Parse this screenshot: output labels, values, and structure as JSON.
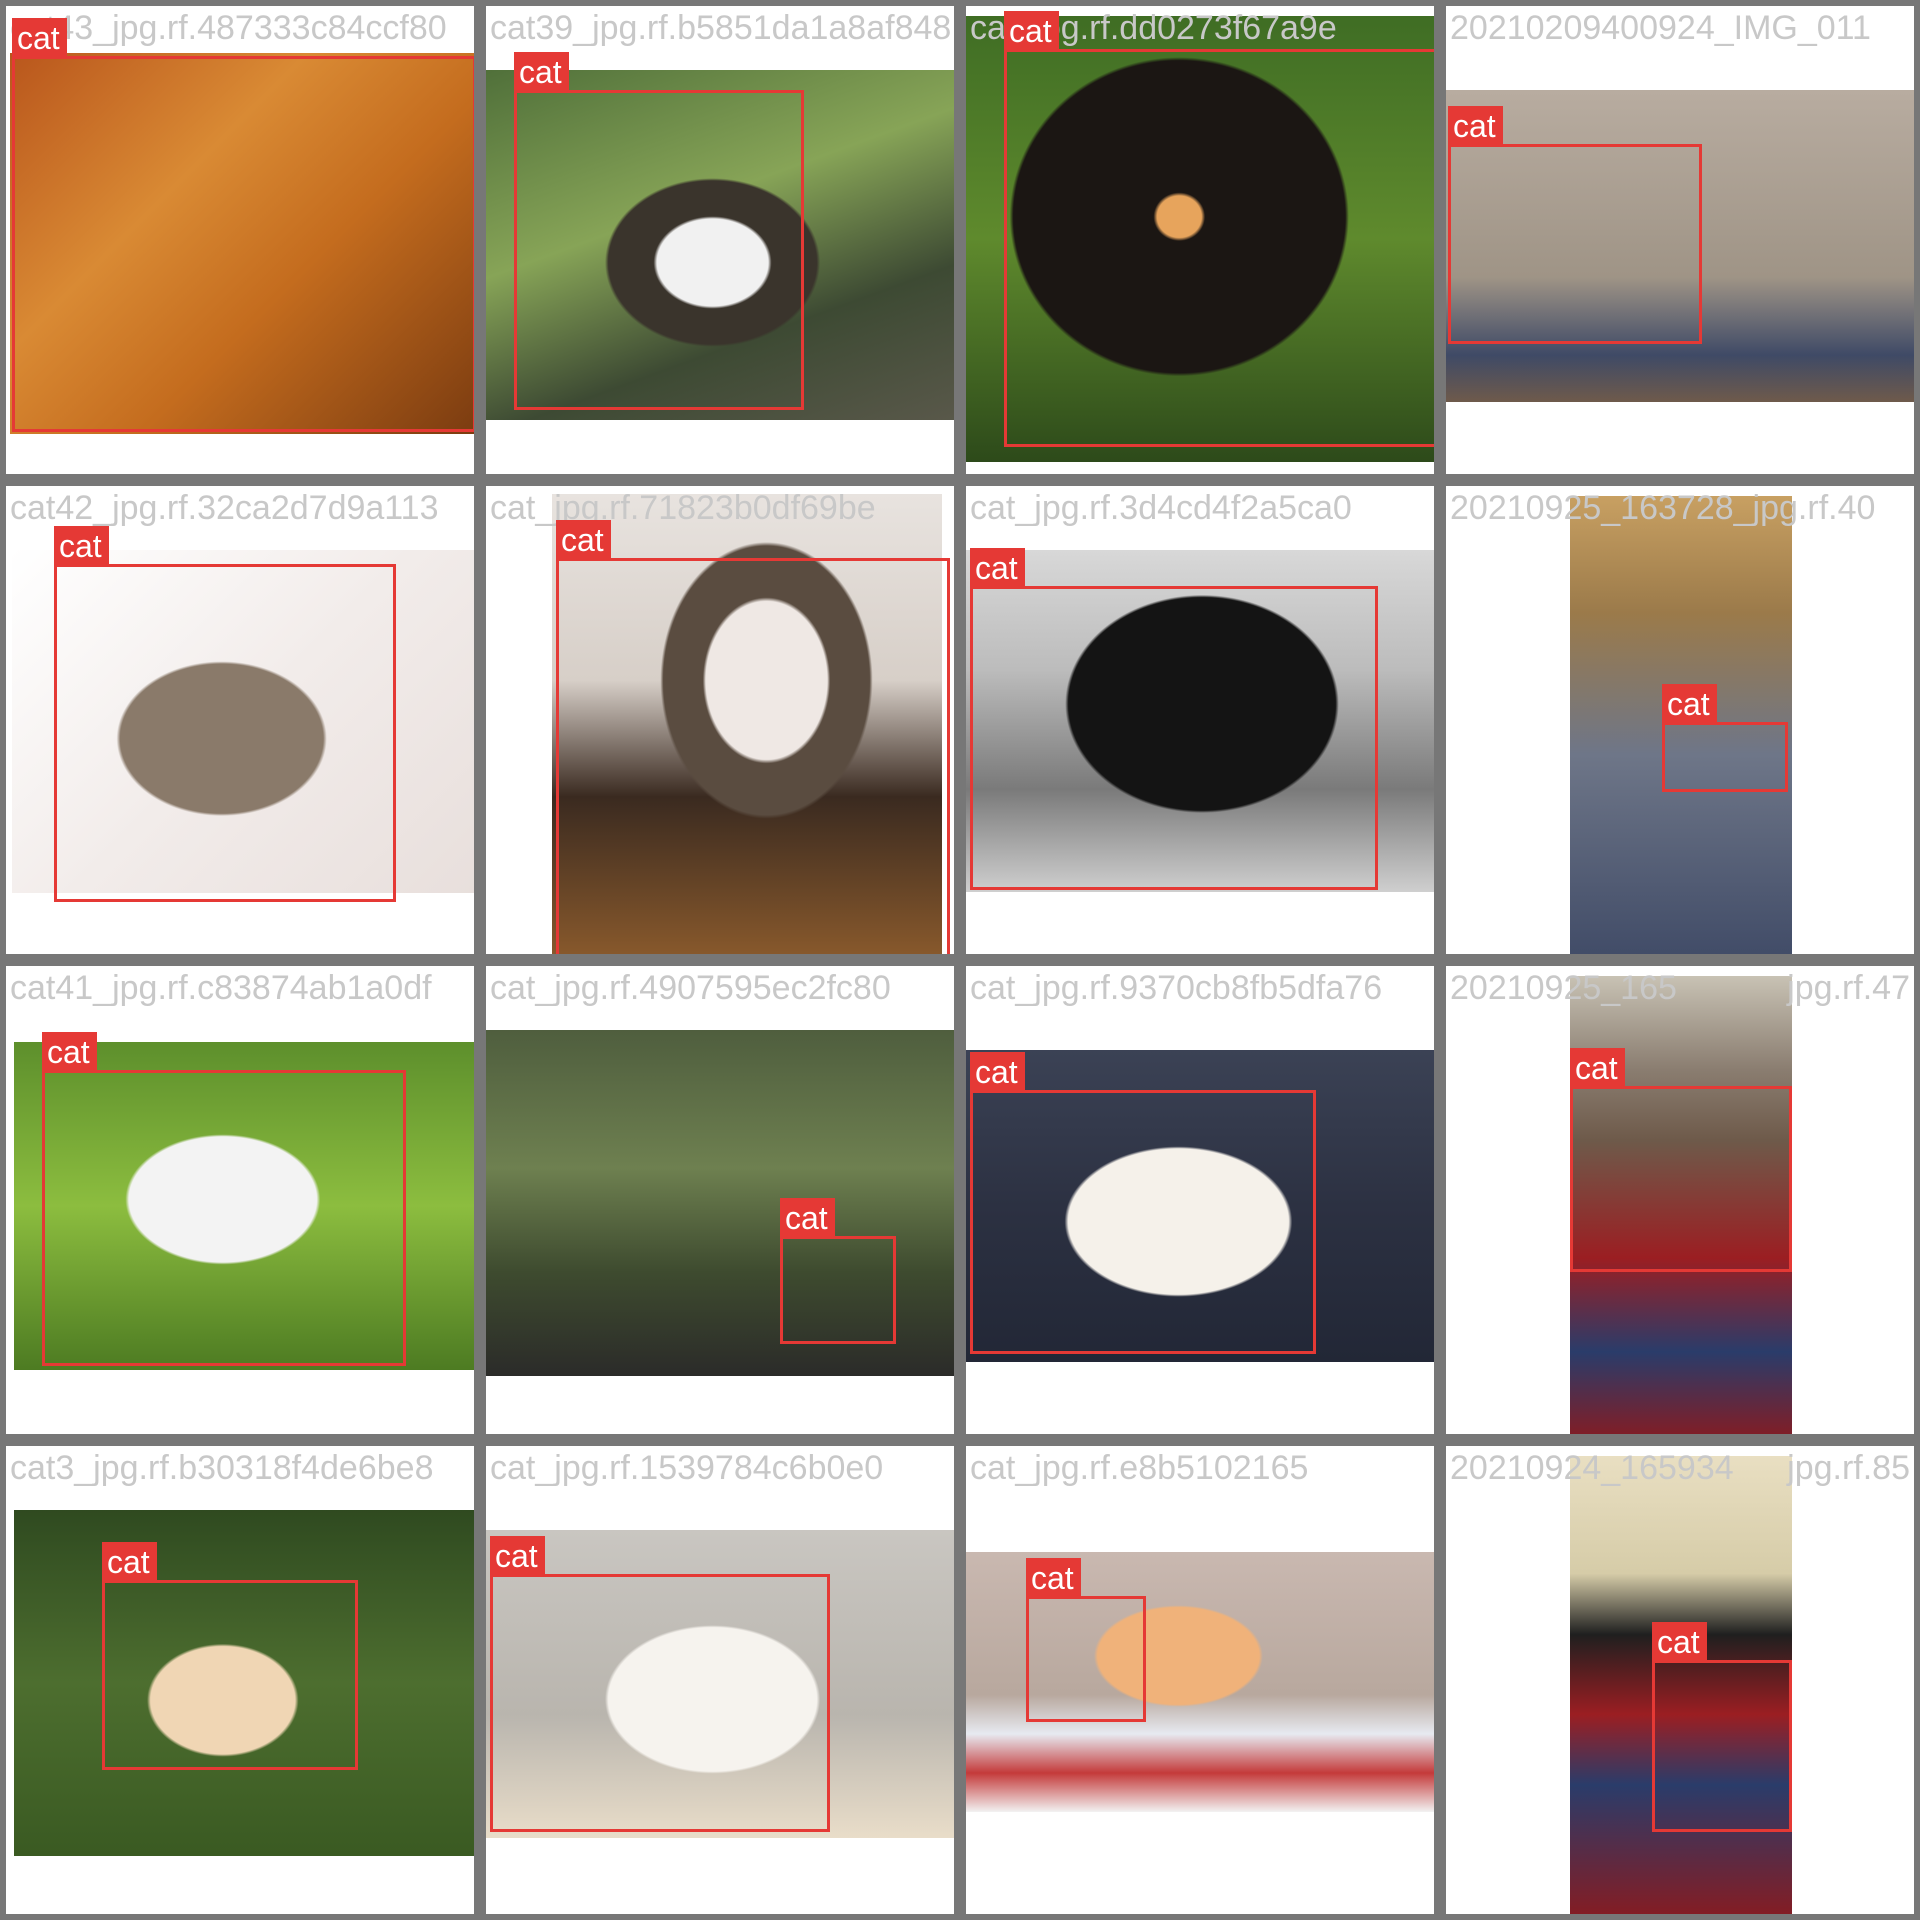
{
  "grid": {
    "rows": 4,
    "cols": 4,
    "border_color": "#777777",
    "box_color": "#e53935",
    "filename_color": "#c8c8c8"
  },
  "tiles": [
    {
      "filename": "cat43_jpg.rf.487333c84ccf80",
      "subject": "orange long-haired cat close-up",
      "boxes": [
        {
          "label": "cat"
        }
      ]
    },
    {
      "filename": "cat39_jpg.rf.b5851da1a8af848",
      "subject": "calico cat standing in garden",
      "boxes": [
        {
          "label": "cat"
        }
      ]
    },
    {
      "filename": "cat_jpg.rf.dd0273f67a9e",
      "subject": "calico cat on grass",
      "boxes": [
        {
          "label": "cat"
        }
      ]
    },
    {
      "filename": "20210209400924_IMG_011",
      "subject": "tabby kitten lying on carpet",
      "boxes": [
        {
          "label": "cat"
        }
      ]
    },
    {
      "filename": "cat42_jpg.rf.32ca2d7d9a113",
      "subject": "grey tabby kitten on white cloth",
      "boxes": [
        {
          "label": "cat"
        }
      ]
    },
    {
      "filename": "cat_jpg.rf.71823b0df69be",
      "subject": "long-haired cat climbing off chair",
      "boxes": [
        {
          "label": "cat"
        }
      ]
    },
    {
      "filename": "cat_jpg.rf.3d4cd4f2a5ca0",
      "subject": "black cat lying on rug",
      "boxes": [
        {
          "label": "cat"
        }
      ]
    },
    {
      "filename": "20210925_163728_jpg.rf.40",
      "subject": "woman holding kitten",
      "boxes": [
        {
          "label": "cat"
        }
      ]
    },
    {
      "filename": "cat41_jpg.rf.c83874ab1a0df",
      "subject": "white cat walking on grass",
      "boxes": [
        {
          "label": "cat"
        }
      ]
    },
    {
      "filename": "cat_jpg.rf.4907595ec2fc80",
      "subject": "cat resting in wild vegetation",
      "boxes": [
        {
          "label": "cat"
        }
      ]
    },
    {
      "filename": "cat_jpg.rf.9370cb8fb5dfa76",
      "subject": "white and tabby cat on lap",
      "boxes": [
        {
          "label": "cat"
        }
      ]
    },
    {
      "filename": "20210925_165",
      "filename_tail": "jpg.rf.47",
      "subject": "kitten lying on red rug",
      "boxes": [
        {
          "label": "cat"
        }
      ]
    },
    {
      "filename": "cat3_jpg.rf.b30318f4de6be8",
      "subject": "orange and white cat in grass",
      "boxes": [
        {
          "label": "cat"
        }
      ]
    },
    {
      "filename": "cat_jpg.rf.1539784c6b0e0",
      "subject": "white cat with brown patches",
      "boxes": [
        {
          "label": "cat"
        }
      ]
    },
    {
      "filename": "cat_jpg.rf.e8b5102165",
      "subject": "orange cat on checkered blanket",
      "boxes": [
        {
          "label": "cat"
        }
      ]
    },
    {
      "filename": "20210924_165934",
      "filename_tail": "jpg.rf.85",
      "subject": "kitten on patterned rug",
      "boxes": [
        {
          "label": "cat"
        }
      ]
    }
  ]
}
